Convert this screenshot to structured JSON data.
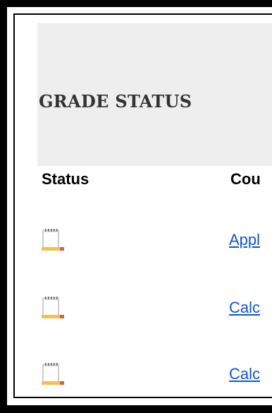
{
  "page": {
    "title": "GRADE STATUS"
  },
  "table": {
    "headers": {
      "status": "Status",
      "course": "Cou"
    },
    "rows": [
      {
        "status_icon": "notepad-pencil-icon",
        "course": "Appl"
      },
      {
        "status_icon": "notepad-pencil-icon",
        "course": "Calc"
      },
      {
        "status_icon": "notepad-pencil-icon",
        "course": "Calc"
      }
    ]
  },
  "colors": {
    "background": "#ffffff",
    "header_band": "#eeeeee",
    "link": "#1155cc",
    "border": "#000000"
  }
}
